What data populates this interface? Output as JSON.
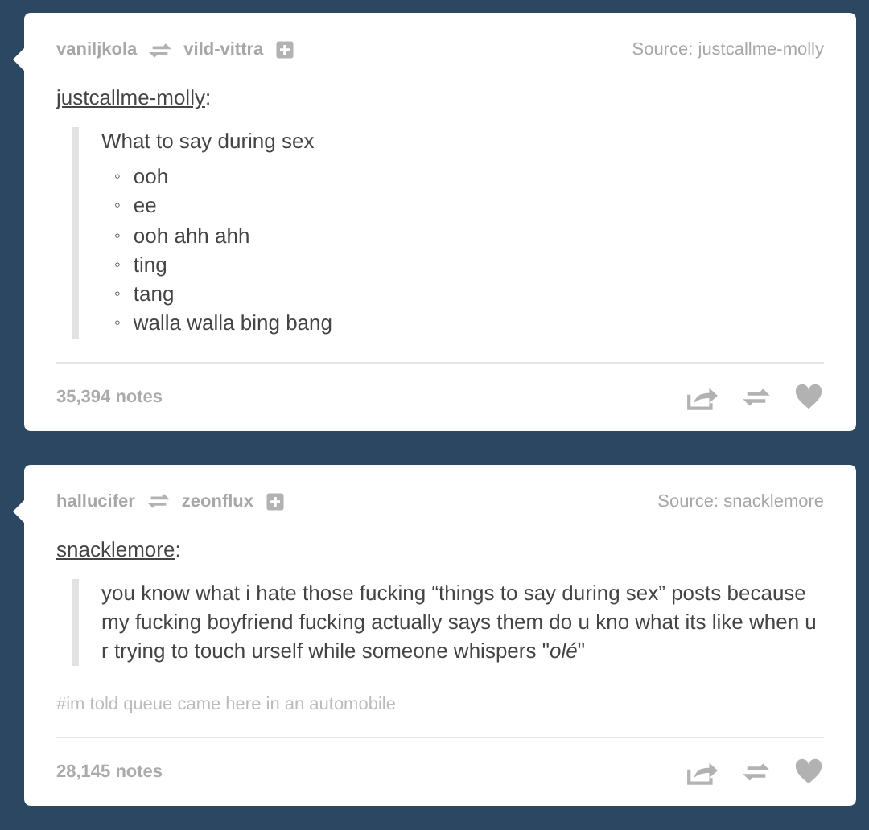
{
  "posts": [
    {
      "reblogger": "vaniljkola",
      "reblogged_from": "vild-vittra",
      "source_label": "Source:",
      "source": "justcallme-molly",
      "author": "justcallme-molly",
      "author_suffix": ":",
      "body": {
        "kind": "list",
        "title": "What to say during sex",
        "marker": "◦",
        "items": [
          "ooh",
          "ee",
          "ooh ahh ahh",
          "ting",
          "tang",
          "walla walla bing bang"
        ]
      },
      "notes": "35,394 notes"
    },
    {
      "reblogger": "hallucifer",
      "reblogged_from": "zeonflux",
      "source_label": "Source:",
      "source": "snacklemore",
      "author": "snacklemore",
      "author_suffix": ":",
      "body": {
        "kind": "text",
        "text": "you know what i hate those fucking “things to say during sex” posts because my fucking boyfriend fucking actually says them do u kno what its like when u r trying to touch urself while someone whispers \"*olé*\""
      },
      "tags": "#im told queue came here in an automobile",
      "notes": "28,145 notes"
    }
  ]
}
